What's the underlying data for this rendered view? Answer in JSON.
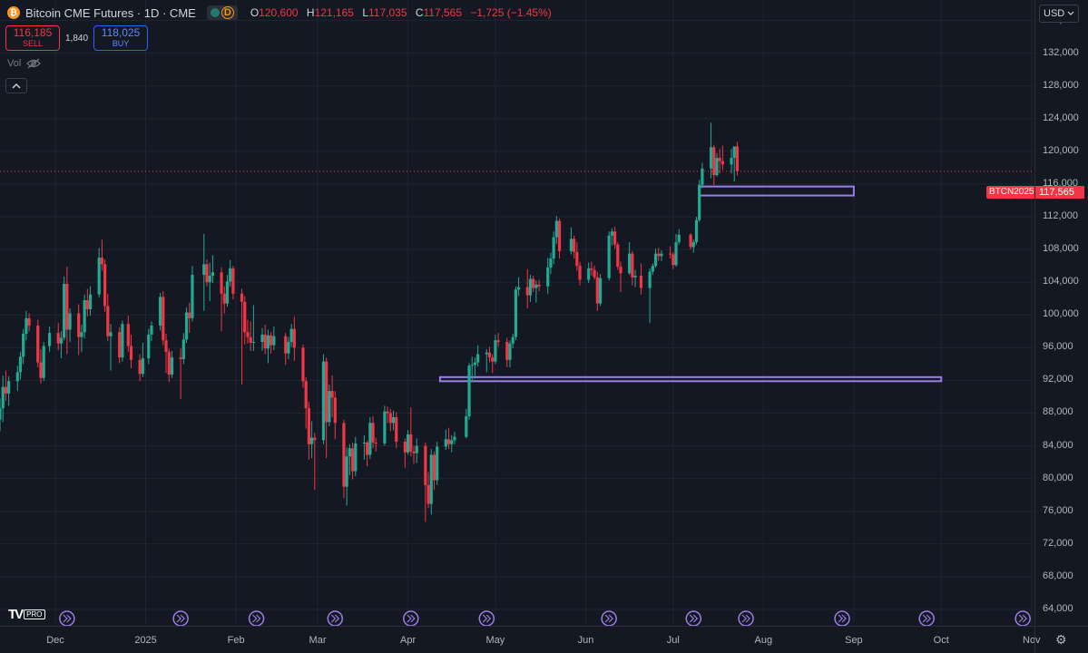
{
  "header": {
    "symbol_icon": "bitcoin-logo",
    "symbol_icon_glyph": "₿",
    "title": "Bitcoin CME Futures · 1D · CME",
    "status_badge": "D",
    "ohlc": [
      {
        "key": "O",
        "value": "120,600"
      },
      {
        "key": "H",
        "value": "121,165"
      },
      {
        "key": "L",
        "value": "117,035"
      },
      {
        "key": "C",
        "value": "117,565"
      },
      {
        "key": "",
        "value": "−1,725 (−1.45%)"
      }
    ]
  },
  "trade": {
    "sell_price": "116,185",
    "sell_label": "SELL",
    "spread": "1,840",
    "buy_price": "118,025",
    "buy_label": "BUY"
  },
  "volume_label": "Vol",
  "currency": "USD",
  "logo_text": "TV",
  "logo_badge": "PRO",
  "last_price": {
    "symbol": "BTCN2025",
    "value": "117,565"
  },
  "colors": {
    "up": "#22ab94",
    "down": "#f23645",
    "zone": "#9b7fe6",
    "background": "#141823"
  },
  "chart_data": {
    "type": "candlestick",
    "title": "Bitcoin CME Futures · 1D · CME",
    "y_ticks": [
      64000,
      68000,
      72000,
      76000,
      80000,
      84000,
      88000,
      92000,
      96000,
      100000,
      104000,
      108000,
      112000,
      116000,
      120000,
      124000,
      128000,
      132000,
      136000
    ],
    "y_tick_labels": [
      "64,000",
      "68,000",
      "72,000",
      "76,000",
      "80,000",
      "84,000",
      "88,000",
      "92,000",
      "96,000",
      "100,000",
      "104,000",
      "108,000",
      "112,000",
      "116,000",
      "120,000",
      "124,000",
      "128,000",
      "132,000",
      "136,000"
    ],
    "ylim": [
      62000,
      138500
    ],
    "x_labels": [
      "Dec",
      "2025",
      "Feb",
      "Mar",
      "Apr",
      "May",
      "Jun",
      "Jul",
      "Aug",
      "Sep",
      "Oct",
      "Nov"
    ],
    "last_close": 117565,
    "zones": [
      {
        "from_date": "2025-07-10",
        "to_date": "2025-09-01",
        "low": 114600,
        "high": 115700
      },
      {
        "from_date": "2025-04-12",
        "to_date": "2025-10-01",
        "low": 91900,
        "high": 92400
      }
    ],
    "candles": [
      [
        "2024-11-12",
        87200,
        89800,
        85800,
        88600
      ],
      [
        "2024-11-13",
        88600,
        92600,
        86900,
        91200
      ],
      [
        "2024-11-14",
        91200,
        93200,
        89500,
        90400
      ],
      [
        "2024-11-15",
        90400,
        92500,
        88900,
        91900
      ],
      [
        "2024-11-18",
        91900,
        93800,
        90700,
        93000
      ],
      [
        "2024-11-19",
        93000,
        95500,
        92100,
        94900
      ],
      [
        "2024-11-20",
        94900,
        98300,
        94000,
        97700
      ],
      [
        "2024-11-21",
        97700,
        100500,
        96900,
        99600
      ],
      [
        "2024-11-22",
        99600,
        100200,
        98000,
        98700
      ],
      [
        "2024-11-25",
        98700,
        99400,
        93600,
        94200
      ],
      [
        "2024-11-26",
        94200,
        95800,
        91600,
        92300
      ],
      [
        "2024-11-27",
        92300,
        96700,
        91900,
        96200
      ],
      [
        "2024-11-29",
        96200,
        98600,
        95500,
        97800
      ],
      [
        "2024-12-02",
        97800,
        99000,
        95700,
        96500
      ],
      [
        "2024-12-03",
        96500,
        98000,
        94700,
        97200
      ],
      [
        "2024-12-04",
        97200,
        104700,
        96900,
        103800
      ],
      [
        "2024-12-05",
        103800,
        105900,
        95200,
        98200
      ],
      [
        "2024-12-06",
        98200,
        100800,
        96700,
        100200
      ],
      [
        "2024-12-09",
        100200,
        101300,
        95100,
        97300
      ],
      [
        "2024-12-10",
        97300,
        98800,
        95500,
        97900
      ],
      [
        "2024-12-11",
        97900,
        102500,
        97100,
        101800
      ],
      [
        "2024-12-12",
        101800,
        103200,
        99800,
        100700
      ],
      [
        "2024-12-13",
        100700,
        103500,
        99900,
        102500
      ],
      [
        "2024-12-16",
        102500,
        108200,
        102100,
        107000
      ],
      [
        "2024-12-17",
        107000,
        109200,
        105400,
        106200
      ],
      [
        "2024-12-18",
        106200,
        106800,
        100400,
        101100
      ],
      [
        "2024-12-19",
        101100,
        102600,
        96800,
        97400
      ],
      [
        "2024-12-20",
        97400,
        98900,
        93200,
        97900
      ],
      [
        "2024-12-23",
        97900,
        98500,
        94100,
        94800
      ],
      [
        "2024-12-24",
        94800,
        99300,
        94300,
        98900
      ],
      [
        "2024-12-26",
        98900,
        99900,
        95500,
        96200
      ],
      [
        "2024-12-27",
        96200,
        97600,
        93500,
        94500
      ],
      [
        "2024-12-30",
        94500,
        95200,
        91900,
        92800
      ],
      [
        "2024-12-31",
        92800,
        96600,
        92400,
        94700
      ],
      [
        "2025-01-02",
        94700,
        98300,
        94000,
        97600
      ],
      [
        "2025-01-03",
        97600,
        99200,
        96800,
        98700
      ],
      [
        "2025-01-06",
        98700,
        102700,
        98100,
        102200
      ],
      [
        "2025-01-07",
        102200,
        102900,
        96300,
        96900
      ],
      [
        "2025-01-08",
        96900,
        97700,
        92900,
        95500
      ],
      [
        "2025-01-09",
        95500,
        95900,
        91800,
        92700
      ],
      [
        "2025-01-10",
        92700,
        95600,
        92300,
        94800
      ],
      [
        "2025-01-13",
        94800,
        95900,
        89700,
        94600
      ],
      [
        "2025-01-14",
        94600,
        97800,
        94000,
        97000
      ],
      [
        "2025-01-15",
        97000,
        100900,
        96600,
        100300
      ],
      [
        "2025-01-16",
        100300,
        101500,
        97800,
        99600
      ],
      [
        "2025-01-17",
        99600,
        106000,
        99200,
        104900
      ],
      [
        "2025-01-21",
        104900,
        109900,
        100500,
        106200
      ],
      [
        "2025-01-22",
        106200,
        106800,
        103500,
        104000
      ],
      [
        "2025-01-23",
        104000,
        106400,
        101700,
        104800
      ],
      [
        "2025-01-24",
        104800,
        107300,
        103900,
        105200
      ],
      [
        "2025-01-27",
        105200,
        105800,
        98000,
        102600
      ],
      [
        "2025-01-28",
        102600,
        103500,
        100200,
        101400
      ],
      [
        "2025-01-29",
        101400,
        104900,
        101000,
        104100
      ],
      [
        "2025-01-30",
        104100,
        106700,
        103500,
        105700
      ],
      [
        "2025-01-31",
        105700,
        106000,
        101900,
        102600
      ],
      [
        "2025-02-03",
        102600,
        103200,
        91500,
        101600
      ],
      [
        "2025-02-04",
        101600,
        102300,
        96400,
        97900
      ],
      [
        "2025-02-05",
        97900,
        99400,
        96500,
        97300
      ],
      [
        "2025-02-06",
        97300,
        99200,
        95600,
        96600
      ],
      [
        "2025-02-07",
        96600,
        101200,
        95600,
        96700
      ],
      [
        "2025-02-10",
        96700,
        98400,
        95600,
        97600
      ],
      [
        "2025-02-11",
        97600,
        98800,
        95200,
        95900
      ],
      [
        "2025-02-12",
        95900,
        98200,
        94100,
        97500
      ],
      [
        "2025-02-13",
        97500,
        97900,
        95300,
        96300
      ],
      [
        "2025-02-14",
        96300,
        98600,
        95700,
        97400
      ],
      [
        "2025-02-18",
        97400,
        97800,
        93900,
        95300
      ],
      [
        "2025-02-19",
        95300,
        97300,
        94600,
        96700
      ],
      [
        "2025-02-20",
        96700,
        98900,
        96100,
        98300
      ],
      [
        "2025-02-21",
        98300,
        99800,
        94400,
        96000
      ],
      [
        "2025-02-24",
        96000,
        96400,
        91100,
        91900
      ],
      [
        "2025-02-25",
        91900,
        92400,
        86100,
        88600
      ],
      [
        "2025-02-26",
        88600,
        89400,
        82300,
        84200
      ],
      [
        "2025-02-27",
        84200,
        87000,
        82500,
        85000
      ],
      [
        "2025-02-28",
        85000,
        85600,
        78600,
        84700
      ],
      [
        "2025-03-03",
        84700,
        95200,
        84200,
        94300
      ],
      [
        "2025-03-04",
        94300,
        94800,
        82500,
        86900
      ],
      [
        "2025-03-05",
        86900,
        91500,
        86400,
        90700
      ],
      [
        "2025-03-06",
        90700,
        92600,
        87500,
        89900
      ],
      [
        "2025-03-07",
        89900,
        90700,
        84800,
        86800
      ],
      [
        "2025-03-10",
        86800,
        87200,
        77600,
        79000
      ],
      [
        "2025-03-11",
        79000,
        83800,
        76700,
        82700
      ],
      [
        "2025-03-12",
        82700,
        84200,
        80400,
        83700
      ],
      [
        "2025-03-13",
        83700,
        84400,
        79900,
        80900
      ],
      [
        "2025-03-14",
        80900,
        85100,
        80300,
        84300
      ],
      [
        "2025-03-17",
        84300,
        85300,
        82300,
        84400
      ],
      [
        "2025-03-18",
        84400,
        84600,
        81500,
        82900
      ],
      [
        "2025-03-19",
        82900,
        87500,
        82400,
        86800
      ],
      [
        "2025-03-20",
        86800,
        87600,
        83700,
        84400
      ],
      [
        "2025-03-21",
        84400,
        85000,
        83300,
        84300
      ],
      [
        "2025-03-24",
        84300,
        88900,
        84000,
        88200
      ],
      [
        "2025-03-25",
        88200,
        88800,
        86800,
        88000
      ],
      [
        "2025-03-26",
        88000,
        88500,
        85800,
        86800
      ],
      [
        "2025-03-27",
        86800,
        88300,
        85900,
        87500
      ],
      [
        "2025-03-28",
        87500,
        88100,
        83700,
        84500
      ],
      [
        "2025-03-31",
        84500,
        84900,
        81300,
        83200
      ],
      [
        "2025-04-01",
        83200,
        85900,
        82900,
        85400
      ],
      [
        "2025-04-02",
        85400,
        88700,
        82700,
        83300
      ],
      [
        "2025-04-03",
        83300,
        84000,
        81800,
        83100
      ],
      [
        "2025-04-04",
        83100,
        84900,
        81900,
        84000
      ],
      [
        "2025-04-07",
        84000,
        84400,
        74700,
        79200
      ],
      [
        "2025-04-08",
        79200,
        80800,
        76400,
        76900
      ],
      [
        "2025-04-09",
        76900,
        83600,
        75600,
        82900
      ],
      [
        "2025-04-10",
        82900,
        83300,
        78600,
        79800
      ],
      [
        "2025-04-11",
        79800,
        84500,
        79200,
        83900
      ],
      [
        "2025-04-14",
        83900,
        86000,
        83500,
        84800
      ],
      [
        "2025-04-15",
        84800,
        86200,
        83600,
        84200
      ],
      [
        "2025-04-16",
        84200,
        85300,
        83200,
        84700
      ],
      [
        "2025-04-17",
        84700,
        85700,
        84200,
        85100
      ],
      [
        "2025-04-21",
        85100,
        88500,
        84900,
        87600
      ],
      [
        "2025-04-22",
        87600,
        94100,
        87200,
        93800
      ],
      [
        "2025-04-23",
        93800,
        94900,
        91800,
        93900
      ],
      [
        "2025-04-24",
        93900,
        94800,
        92200,
        94200
      ],
      [
        "2025-04-25",
        94200,
        96300,
        93700,
        95200
      ],
      [
        "2025-04-28",
        95200,
        95800,
        93000,
        95400
      ],
      [
        "2025-04-29",
        95400,
        96100,
        94200,
        94800
      ],
      [
        "2025-04-30",
        94800,
        95200,
        92900,
        94300
      ],
      [
        "2025-05-01",
        94300,
        97600,
        94000,
        96900
      ],
      [
        "2025-05-02",
        96900,
        97800,
        96100,
        96700
      ],
      [
        "2025-05-05",
        96700,
        97200,
        93600,
        94500
      ],
      [
        "2025-05-06",
        94500,
        96900,
        93600,
        96500
      ],
      [
        "2025-05-07",
        96500,
        97700,
        95900,
        97300
      ],
      [
        "2025-05-08",
        97300,
        103500,
        96900,
        103100
      ],
      [
        "2025-05-09",
        103100,
        104600,
        102300,
        103400
      ],
      [
        "2025-05-12",
        103400,
        105600,
        100800,
        102400
      ],
      [
        "2025-05-13",
        102400,
        104900,
        101600,
        104400
      ],
      [
        "2025-05-14",
        104400,
        104800,
        102800,
        103300
      ],
      [
        "2025-05-15",
        103300,
        104200,
        101500,
        103700
      ],
      [
        "2025-05-16",
        103700,
        104300,
        102900,
        103500
      ],
      [
        "2025-05-19",
        103500,
        107000,
        102600,
        105800
      ],
      [
        "2025-05-20",
        105800,
        107600,
        105000,
        106900
      ],
      [
        "2025-05-21",
        106900,
        110200,
        106200,
        109500
      ],
      [
        "2025-05-22",
        109500,
        112100,
        108700,
        111500
      ],
      [
        "2025-05-23",
        111500,
        111800,
        106900,
        107800
      ],
      [
        "2025-05-27",
        107800,
        110700,
        107400,
        109300
      ],
      [
        "2025-05-28",
        109300,
        109700,
        106900,
        107700
      ],
      [
        "2025-05-29",
        107700,
        108900,
        105400,
        106000
      ],
      [
        "2025-05-30",
        106000,
        106500,
        103600,
        104300
      ],
      [
        "2025-06-02",
        104300,
        106400,
        103900,
        105700
      ],
      [
        "2025-06-03",
        105700,
        106500,
        104800,
        105500
      ],
      [
        "2025-06-04",
        105500,
        106000,
        104300,
        104600
      ],
      [
        "2025-06-05",
        104600,
        105300,
        100500,
        101400
      ],
      [
        "2025-06-06",
        101400,
        105000,
        101100,
        104500
      ],
      [
        "2025-06-09",
        104500,
        110200,
        104200,
        109700
      ],
      [
        "2025-06-10",
        109700,
        110600,
        108500,
        110200
      ],
      [
        "2025-06-11",
        110200,
        110800,
        108100,
        108600
      ],
      [
        "2025-06-12",
        108600,
        108900,
        105500,
        105900
      ],
      [
        "2025-06-13",
        105900,
        106500,
        102800,
        105100
      ],
      [
        "2025-06-16",
        105100,
        108900,
        104900,
        107500
      ],
      [
        "2025-06-17",
        107500,
        107800,
        103600,
        104600
      ],
      [
        "2025-06-18",
        104600,
        105500,
        103400,
        104800
      ],
      [
        "2025-06-20",
        104800,
        106300,
        102500,
        103300
      ],
      [
        "2025-06-23",
        103300,
        105700,
        99000,
        105300
      ],
      [
        "2025-06-24",
        105300,
        106300,
        104900,
        106000
      ],
      [
        "2025-06-25",
        106000,
        108100,
        105800,
        107500
      ],
      [
        "2025-06-26",
        107500,
        108200,
        106600,
        107200
      ],
      [
        "2025-06-27",
        107200,
        107900,
        106600,
        107500
      ],
      [
        "2025-06-30",
        107500,
        108400,
        106900,
        107400
      ],
      [
        "2025-07-01",
        107400,
        107700,
        105600,
        106100
      ],
      [
        "2025-07-02",
        106100,
        109900,
        105900,
        108900
      ],
      [
        "2025-07-03",
        108900,
        110500,
        108600,
        109800
      ],
      [
        "2025-07-07",
        109800,
        110000,
        108000,
        108300
      ],
      [
        "2025-07-08",
        108300,
        109200,
        107600,
        108900
      ],
      [
        "2025-07-09",
        108900,
        112000,
        108600,
        111600
      ],
      [
        "2025-07-10",
        111600,
        116500,
        111400,
        115900
      ],
      [
        "2025-07-11",
        115900,
        118600,
        115500,
        117900
      ],
      [
        "2025-07-14",
        117900,
        123500,
        116700,
        120500
      ],
      [
        "2025-07-15",
        120500,
        120800,
        115900,
        117100
      ],
      [
        "2025-07-16",
        117100,
        119800,
        116900,
        119200
      ],
      [
        "2025-07-17",
        119200,
        120300,
        117300,
        118800
      ],
      [
        "2025-07-18",
        118800,
        120700,
        117700,
        118400
      ],
      [
        "2025-07-21",
        118400,
        120300,
        117300,
        119200
      ],
      [
        "2025-07-22",
        119200,
        120500,
        116300,
        120600
      ],
      [
        "2025-07-23",
        120600,
        121165,
        117035,
        117565
      ]
    ]
  }
}
